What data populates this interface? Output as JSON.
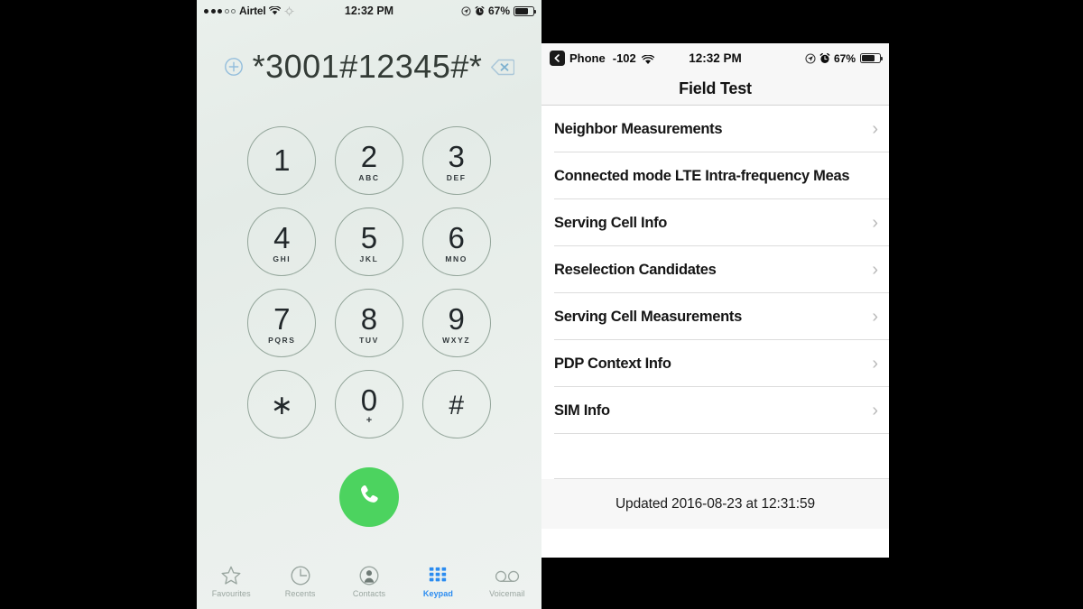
{
  "left_phone": {
    "status_bar": {
      "signal_filled": 3,
      "signal_empty": 2,
      "carrier": "Airtel",
      "wifi_icon": "wifi-icon",
      "sync_icon": "sync-icon",
      "time": "12:32 PM",
      "location_icon": "location-arrow-icon",
      "alarm_icon": "alarm-clock-icon",
      "battery_percent": "67%",
      "battery_icon": "battery-icon"
    },
    "dialer": {
      "add_contact_icon": "add-contact-icon",
      "number": "*3001#12345#*",
      "delete_icon": "delete-backspace-icon"
    },
    "keys": [
      {
        "num": "1",
        "sub": ""
      },
      {
        "num": "2",
        "sub": "ABC"
      },
      {
        "num": "3",
        "sub": "DEF"
      },
      {
        "num": "4",
        "sub": "GHI"
      },
      {
        "num": "5",
        "sub": "JKL"
      },
      {
        "num": "6",
        "sub": "MNO"
      },
      {
        "num": "7",
        "sub": "PQRS"
      },
      {
        "num": "8",
        "sub": "TUV"
      },
      {
        "num": "9",
        "sub": "WXYZ"
      },
      {
        "num": "∗",
        "sub": ""
      },
      {
        "num": "0",
        "sub": "+"
      },
      {
        "num": "#",
        "sub": ""
      }
    ],
    "call_button": {
      "icon": "phone-handset-icon",
      "color": "#4cd35f"
    },
    "tabbar": {
      "active_color": "#2b8cf0",
      "inactive_color": "#9aa6a0",
      "items": [
        {
          "label": "Favourites",
          "icon": "star-icon",
          "active": false
        },
        {
          "label": "Recents",
          "icon": "clock-icon",
          "active": false
        },
        {
          "label": "Contacts",
          "icon": "person-icon",
          "active": false
        },
        {
          "label": "Keypad",
          "icon": "keypad-dots-icon",
          "active": true
        },
        {
          "label": "Voicemail",
          "icon": "voicemail-icon",
          "active": false
        }
      ]
    }
  },
  "right_phone": {
    "status_bar": {
      "back_icon": "back-chevron-icon",
      "back_label": "Phone",
      "signal_dbm": "-102",
      "wifi_icon": "wifi-icon",
      "time": "12:32 PM",
      "location_icon": "location-arrow-icon",
      "alarm_icon": "alarm-clock-icon",
      "battery_percent": "67%",
      "battery_icon": "battery-icon"
    },
    "navbar": {
      "title": "Field Test"
    },
    "menu_items": [
      {
        "label": "Neighbor Measurements",
        "chevron": "chevron-right-icon"
      },
      {
        "label": "Connected mode LTE Intra-frequency Meas",
        "chevron": "chevron-right-icon"
      },
      {
        "label": "Serving Cell Info",
        "chevron": "chevron-right-icon"
      },
      {
        "label": "Reselection Candidates",
        "chevron": "chevron-right-icon"
      },
      {
        "label": "Serving Cell Measurements",
        "chevron": "chevron-right-icon"
      },
      {
        "label": "PDP Context Info",
        "chevron": "chevron-right-icon"
      },
      {
        "label": "SIM Info",
        "chevron": "chevron-right-icon"
      }
    ],
    "footer": {
      "updated_text": "Updated 2016-08-23 at 12:31:59"
    }
  }
}
